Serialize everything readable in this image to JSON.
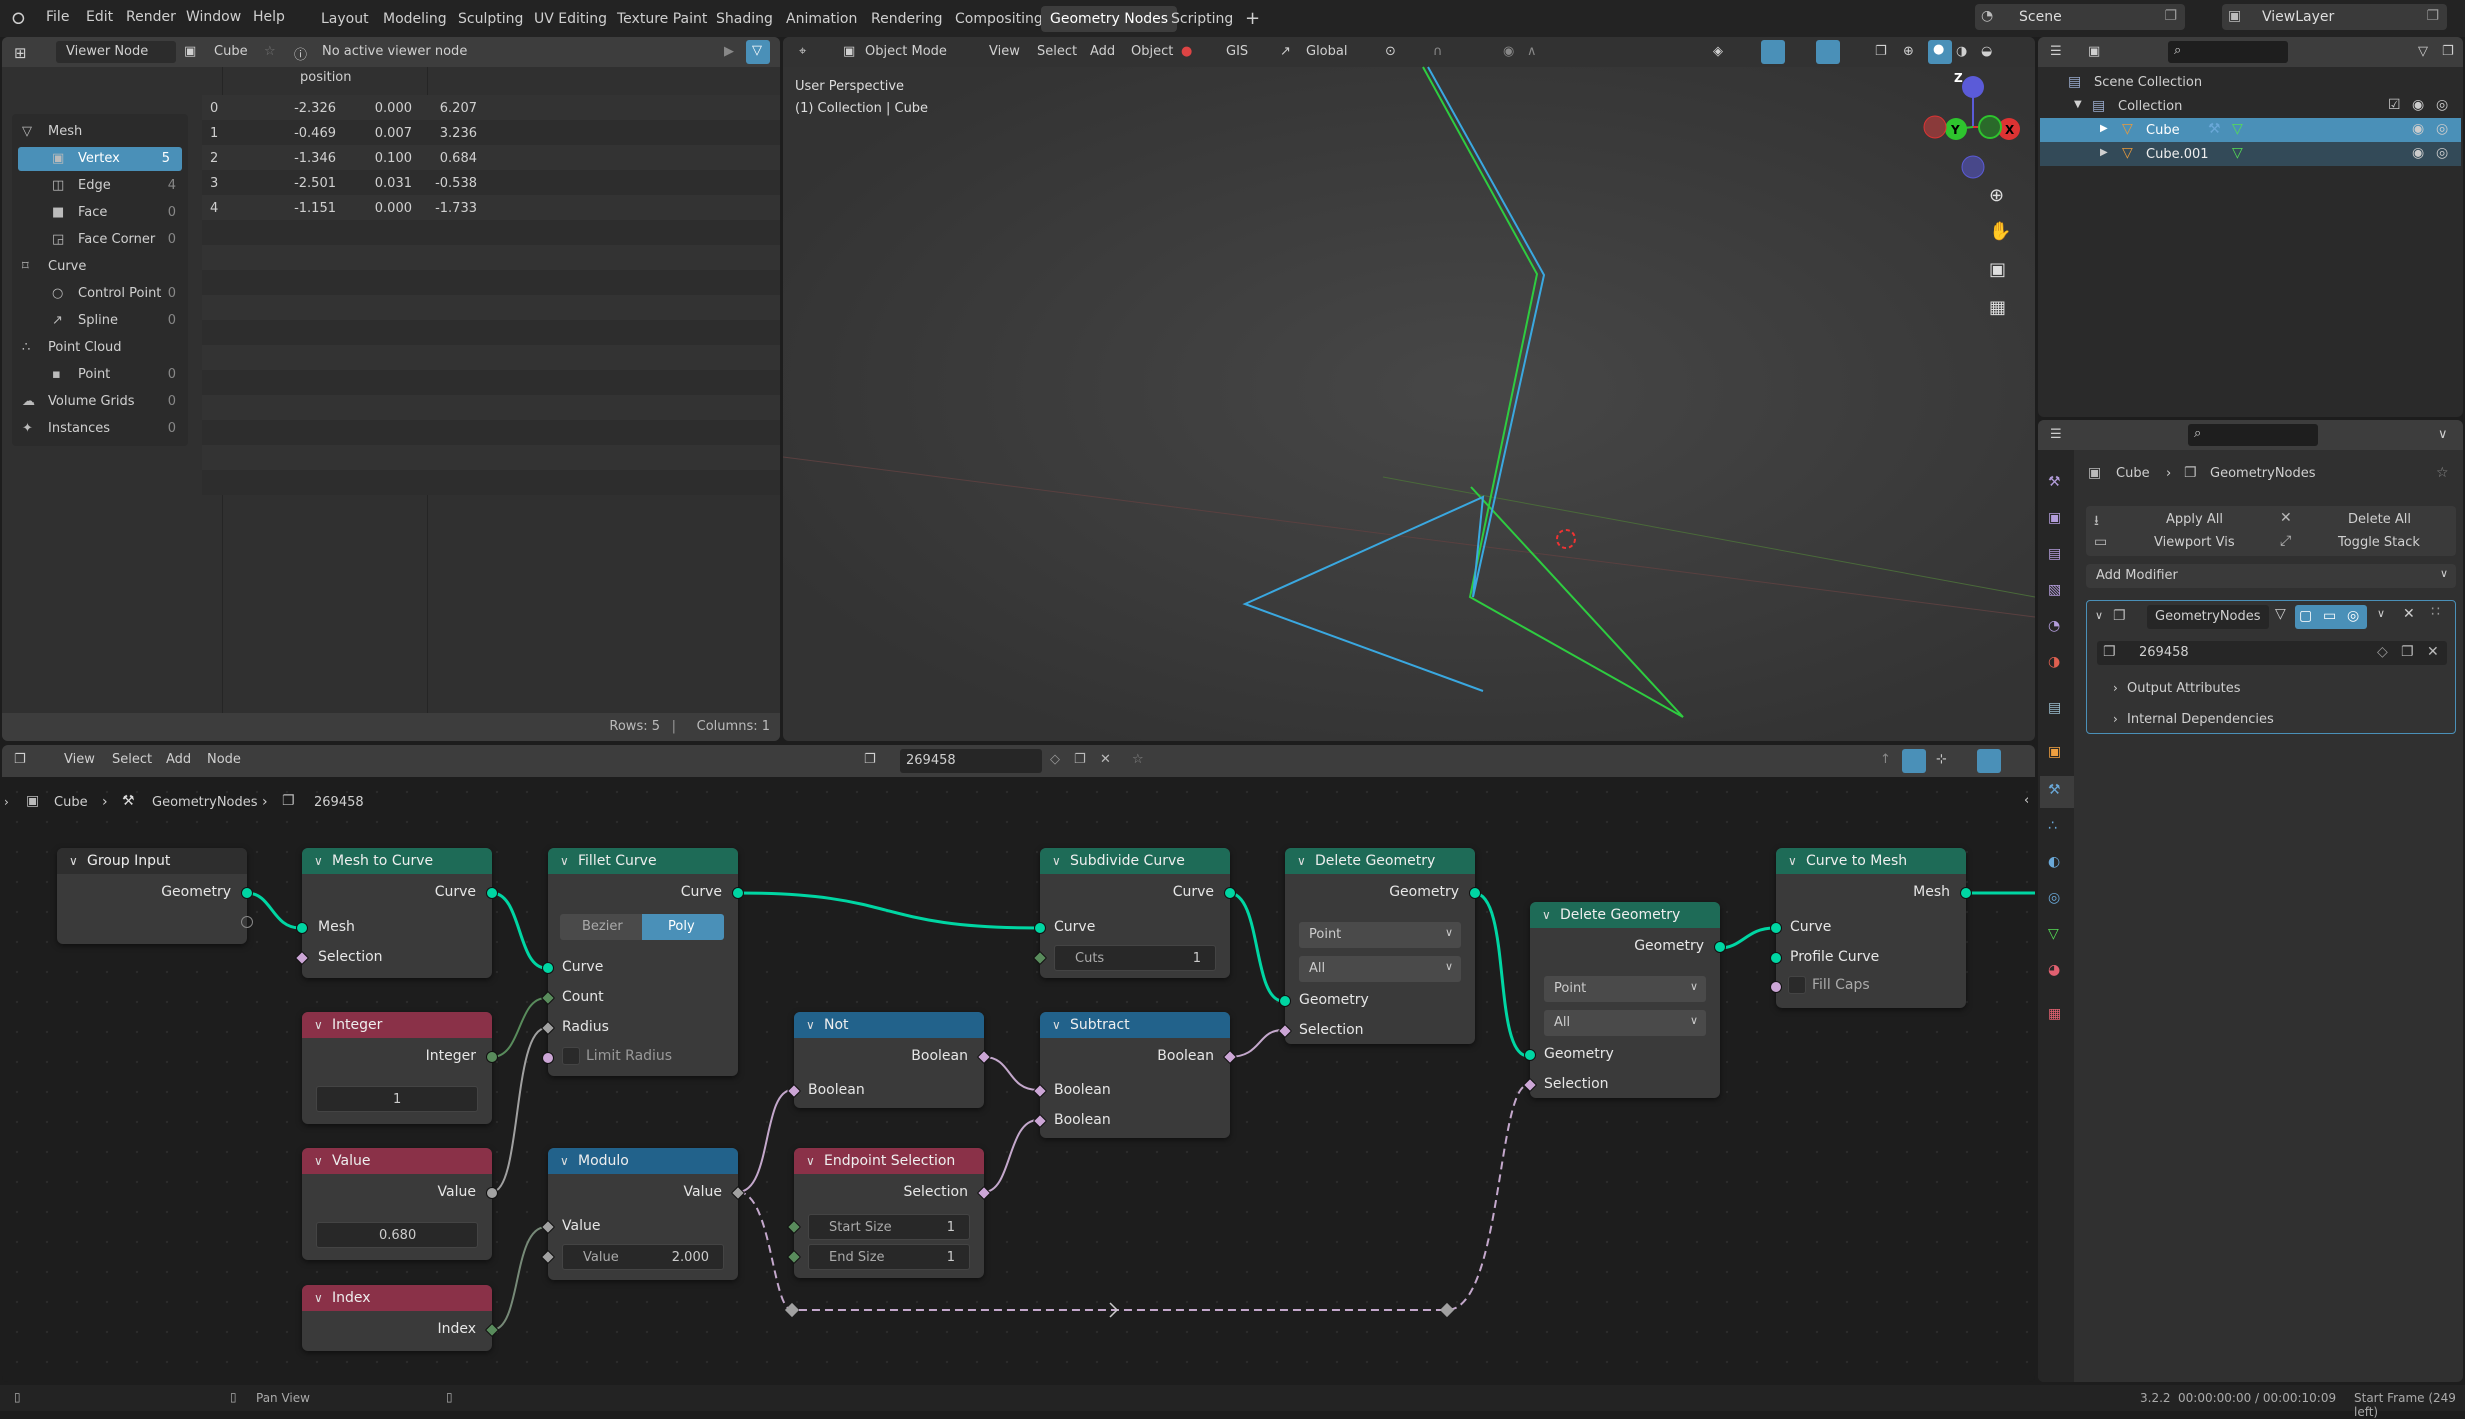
{
  "topbar": {
    "menus": [
      "File",
      "Edit",
      "Render",
      "Window",
      "Help"
    ],
    "workspaces": [
      "Layout",
      "Modeling",
      "Sculpting",
      "UV Editing",
      "Texture Paint",
      "Shading",
      "Animation",
      "Rendering",
      "Compositing",
      "Geometry Nodes",
      "Scripting"
    ],
    "active_workspace": "Geometry Nodes",
    "add_workspace": "+",
    "scene": "Scene",
    "view_layer": "ViewLayer"
  },
  "spreadsheet": {
    "header": {
      "mode": "Viewer Node",
      "object": "Cube",
      "info": "No active viewer node"
    },
    "domains": [
      {
        "label": "Mesh",
        "count": "",
        "icon": "mesh-icon",
        "indent": 0
      },
      {
        "label": "Vertex",
        "count": "5",
        "icon": "vertex-icon",
        "indent": 1,
        "selected": true
      },
      {
        "label": "Edge",
        "count": "4",
        "icon": "edge-icon",
        "indent": 1
      },
      {
        "label": "Face",
        "count": "0",
        "icon": "face-icon",
        "indent": 1
      },
      {
        "label": "Face Corner",
        "count": "0",
        "icon": "face-corner-icon",
        "indent": 1
      },
      {
        "label": "Curve",
        "count": "",
        "icon": "curve-icon",
        "indent": 0
      },
      {
        "label": "Control Point",
        "count": "0",
        "icon": "control-point-icon",
        "indent": 1
      },
      {
        "label": "Spline",
        "count": "0",
        "icon": "spline-icon",
        "indent": 1
      },
      {
        "label": "Point Cloud",
        "count": "",
        "icon": "point-cloud-icon",
        "indent": 0
      },
      {
        "label": "Point",
        "count": "0",
        "icon": "point-icon",
        "indent": 1
      },
      {
        "label": "Volume Grids",
        "count": "0",
        "icon": "volume-icon",
        "indent": 0
      },
      {
        "label": "Instances",
        "count": "0",
        "icon": "instances-icon",
        "indent": 0
      }
    ],
    "column_header": "position",
    "rows": [
      [
        "0",
        "-2.326",
        "0.000",
        "6.207"
      ],
      [
        "1",
        "-0.469",
        "0.007",
        "3.236"
      ],
      [
        "2",
        "-1.346",
        "0.100",
        "0.684"
      ],
      [
        "3",
        "-2.501",
        "0.031",
        "-0.538"
      ],
      [
        "4",
        "-1.151",
        "0.000",
        "-1.733"
      ]
    ],
    "footer": {
      "rows": "Rows: 5",
      "sep": "|",
      "columns": "Columns: 1"
    }
  },
  "viewport": {
    "header": {
      "mode": "Object Mode",
      "menus": [
        "View",
        "Select",
        "Add",
        "Object"
      ],
      "gis": "GIS",
      "orientation": "Global"
    },
    "overlay_title": "User Perspective",
    "overlay_sub": "(1) Collection | Cube",
    "gizmo": {
      "x": "X",
      "y": "Y",
      "z": "Z"
    }
  },
  "outliner": {
    "items": [
      {
        "label": "Scene Collection",
        "level": 0
      },
      {
        "label": "Collection",
        "level": 1
      },
      {
        "label": "Cube",
        "level": 2,
        "selected": true
      },
      {
        "label": "Cube.001",
        "level": 2
      }
    ]
  },
  "properties": {
    "breadcrumb": [
      "Cube",
      "GeometryNodes"
    ],
    "apply_all": "Apply All",
    "delete_all": "Delete All",
    "viewport_vis": "Viewport Vis",
    "toggle_stack": "Toggle Stack",
    "add_modifier": "Add Modifier",
    "modifier_name": "GeometryNodes",
    "node_group": "269458",
    "output_attributes": "Output Attributes",
    "internal_dependencies": "Internal Dependencies"
  },
  "node_editor": {
    "menus": [
      "View",
      "Select",
      "Add",
      "Node"
    ],
    "node_group": "269458",
    "breadcrumb": [
      "Cube",
      "GeometryNodes",
      "269458"
    ],
    "nodes": {
      "group_input": {
        "title": "Group Input",
        "out": "Geometry"
      },
      "mesh_to_curve": {
        "title": "Mesh to Curve",
        "out": "Curve",
        "in1": "Mesh",
        "in2": "Selection"
      },
      "fillet_curve": {
        "title": "Fillet Curve",
        "out": "Curve",
        "mode_a": "Bezier",
        "mode_b": "Poly",
        "in1": "Curve",
        "in2": "Count",
        "in3": "Radius",
        "in4": "Limit Radius"
      },
      "integer": {
        "title": "Integer",
        "out": "Integer",
        "value": "1"
      },
      "value": {
        "title": "Value",
        "out": "Value",
        "value": "0.680"
      },
      "index": {
        "title": "Index",
        "out": "Index"
      },
      "modulo": {
        "title": "Modulo",
        "out": "Value",
        "in1": "Value",
        "in2_label": "Value",
        "in2_value": "2.000"
      },
      "not": {
        "title": "Not",
        "out": "Boolean",
        "in1": "Boolean"
      },
      "endpoint": {
        "title": "Endpoint Selection",
        "out": "Selection",
        "start_label": "Start Size",
        "start": "1",
        "end_label": "End Size",
        "end": "1"
      },
      "subdivide": {
        "title": "Subdivide Curve",
        "out": "Curve",
        "in1": "Curve",
        "cuts_label": "Cuts",
        "cuts": "1"
      },
      "subtract": {
        "title": "Subtract",
        "out": "Boolean",
        "in1": "Boolean",
        "in2": "Boolean"
      },
      "delete1": {
        "title": "Delete Geometry",
        "out": "Geometry",
        "domain": "Point",
        "mode": "All",
        "in1": "Geometry",
        "in2": "Selection"
      },
      "delete2": {
        "title": "Delete Geometry",
        "out": "Geometry",
        "domain": "Point",
        "mode": "All",
        "in1": "Geometry",
        "in2": "Selection"
      },
      "curve_to_mesh": {
        "title": "Curve to Mesh",
        "out": "Mesh",
        "in1": "Curve",
        "in2": "Profile Curve",
        "in3": "Fill Caps"
      }
    }
  },
  "statusbar": {
    "action": "Pan View",
    "version": "3.2.2",
    "time": "00:00:00:00 / 00:00:10:09",
    "frame": "Start Frame (249 left)"
  }
}
